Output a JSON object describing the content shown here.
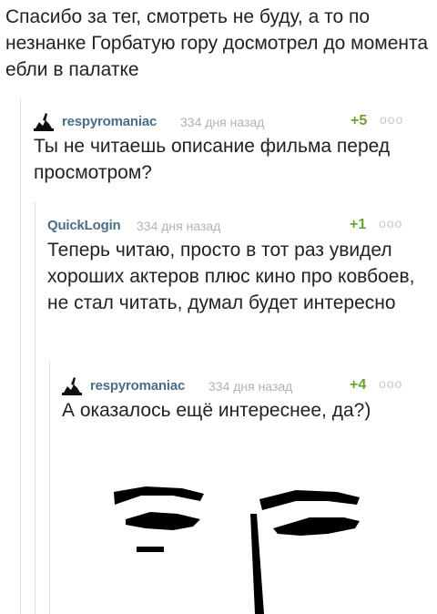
{
  "post": {
    "text": "Спасибо за тег, смотреть не буду, а то по незнанке Горбатую гору досмотрел до момента ебли в палатке"
  },
  "comments": [
    {
      "user": "respyromaniac",
      "time": "334 дня назад",
      "rating": "+5",
      "more": "ooo",
      "text": "Ты не читаешь описание фильма перед просмотром?"
    },
    {
      "user": "QuickLogin",
      "time": "334 дня назад",
      "rating": "+1",
      "more": "ooo",
      "text": "Теперь читаю, просто в тот раз увидел хороших актеров плюс кино про ковбоев, не стал читать, думал будет интересно"
    },
    {
      "user": "respyromaniac",
      "time": "334 дня назад",
      "rating": "+4",
      "more": "ooo",
      "text": "А оказалось ещё интереснее, да?)"
    }
  ]
}
